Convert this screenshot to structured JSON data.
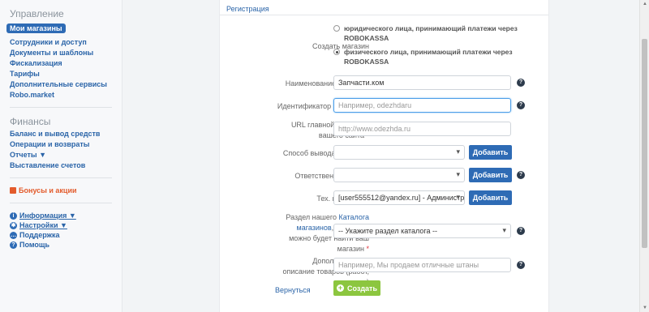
{
  "sidebar": {
    "management_title": "Управление",
    "management_items": [
      {
        "label": "Мои магазины",
        "active": true
      },
      {
        "label": "Сотрудники и доступ"
      },
      {
        "label": "Документы и шаблоны"
      },
      {
        "label": "Фискализация"
      },
      {
        "label": "Тарифы"
      },
      {
        "label": "Дополнительные сервисы"
      },
      {
        "label": "Robo.market"
      }
    ],
    "finance_title": "Финансы",
    "finance_items": [
      {
        "label": "Баланс и вывод средств"
      },
      {
        "label": "Операции и возвраты"
      },
      {
        "label": "Отчеты ▼"
      },
      {
        "label": "Выставление счетов"
      }
    ],
    "promo_label": "Бонусы и акции",
    "util_items": [
      {
        "label": "Информация ▼",
        "icon": "info-icon"
      },
      {
        "label": "Настройки ▼",
        "icon": "gear-icon"
      },
      {
        "label": "Поддержка",
        "icon": "chat-icon"
      },
      {
        "label": "Помощь",
        "icon": "question-icon"
      }
    ]
  },
  "form": {
    "title": "Регистрация",
    "create_shop_label": "Создать магазин",
    "radio_legal": "юридического лица, принимающий платежи через ROBOKASSA",
    "radio_physical": "физического лица, принимающий платежи через ROBOKASSA",
    "name_label": "Наименование магазина",
    "name_value": "Запчасти.ком",
    "id_label": "Идентификатор магазина",
    "id_placeholder": "Например, odezhdaru",
    "url_label_1": "URL главной страницы",
    "url_label_2": "вашего сайта",
    "url_placeholder": "http://www.odezhda.ru",
    "withdraw_label": "Способ вывода средств",
    "responsible_label": "Ответственное лицо",
    "support_label": "Тех. поддержка",
    "support_value": "[user555512@yandex.ru] - Администр...",
    "add_label": "Добавить",
    "catalog_label_1": "Раздел нашего",
    "catalog_link": "Каталога магазинов",
    "catalog_label_2": ", в котором можно будет найти ваш магазин",
    "catalog_value": "-- Укажите раздел каталога --",
    "desc_label": "Дополнительное описание товаров (работ, услуг)",
    "desc_placeholder": "Например, Мы продаем отличные штаны",
    "back_label": "Вернуться",
    "create_label": "Создать",
    "help_glyph": "?",
    "required_mark": "*"
  }
}
